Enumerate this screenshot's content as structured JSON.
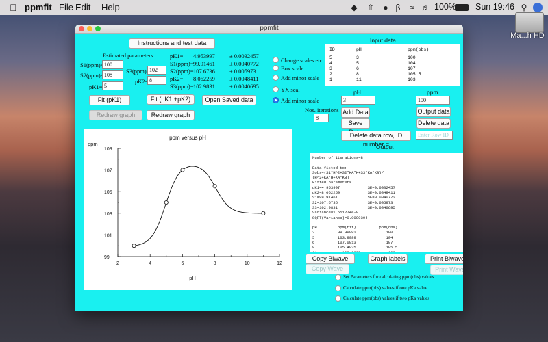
{
  "menubar": {
    "app_name": "ppmfit",
    "menus": [
      "File",
      "Edit",
      "Help"
    ],
    "battery": "100%",
    "clock": "Sun 19:46"
  },
  "desktop": {
    "hd_label": "Ma...h HD"
  },
  "window": {
    "title": "ppmfit"
  },
  "buttons": {
    "instructions": "Instructions and test data",
    "fit_pk1": "Fit (pK1)",
    "fit_pk1_pk2": "Fit (pK1 +pK2)",
    "open_saved": "Open Saved data",
    "redraw_disabled": "Redraw graph",
    "redraw": "Redraw graph",
    "add_data": "Add Data",
    "save_data": "Save Data",
    "delete_row": "Delete data row, ID number =",
    "output_data": "Output data",
    "delete_data": "Delete data",
    "copy_biwave": "Copy Biwave",
    "copy_wave": "Copy Wave",
    "graph_labels": "Graph labels",
    "print_biwave": "Print Biwave",
    "print_wave": "Print Wave"
  },
  "params": {
    "estimated_label": "Estimated parameters",
    "s1_label": "S1(ppm)=",
    "s1_value": "100",
    "s2_label": "S2(ppm)=",
    "s2_value": "108",
    "pk1_label": "pK1=",
    "pk1_value": "5",
    "s3_label": "S3(ppm)=",
    "s3_value": "102",
    "pk2_label": "pK2=",
    "pk2_value": "8",
    "nos_label": "Nos. iterations",
    "nos_value": "8"
  },
  "results": [
    {
      "label": "pK1=",
      "value": "4.953997",
      "err": "± 0.0032457"
    },
    {
      "label": "S1(ppm)=",
      "value": "99.91461",
      "err": "± 0.0040772"
    },
    {
      "label": "S2(ppm)=",
      "value": "107.6736",
      "err": "± 0.005973"
    },
    {
      "label": "pK2=",
      "value": "8.062259",
      "err": "± 0.0048411"
    },
    {
      "label": "S3(ppm)=",
      "value": "102.9831",
      "err": "± 0.0040695"
    }
  ],
  "radios": {
    "change_scales": "Change scales etc",
    "box_scale": "Box scale",
    "add_minor_1": "Add minor scale",
    "yx_scal": "YX scal",
    "add_minor_2": "Add minor scale"
  },
  "input_data": {
    "title": "Input data",
    "headers": [
      "ID",
      "pH",
      "ppm(obs)"
    ],
    "rows": [
      [
        "5",
        "3",
        "100"
      ],
      [
        "4",
        "5",
        "104"
      ],
      [
        "3",
        "6",
        "107"
      ],
      [
        "2",
        "8",
        "105.5"
      ],
      [
        "1",
        "11",
        "103"
      ]
    ],
    "ph_label": "pH",
    "ph_value": "3",
    "ppm_label": "ppm",
    "ppm_value": "100",
    "row_id_placeholder": "Enter Row ID"
  },
  "output": {
    "title": "Output",
    "text": "Number of iterations=8\n\nData fitted to:-\nSobs=(S1*H^2+S2*KA*H+S3*KA*KB)/\n(H^2+KA*H+KA*KB)\nFitted parameters\npK1=4.953997            SE=0.0032457\npK2=8.062259            SE=0.0048411\nS1=99.91461             SE=0.0040772\nS2=107.6736             SE=0.005973\nS3=102.9831             SE=0.0040695\nVariance=1.551274e-9\nSQRT(Variance)=0.0000394\n\npH         ppm(fit)          ppm(obs)\n3          99.99992             100\n5          103.9989             104\n6          107.0013             107\n8          105.4935             105.5\n11           102.9985            103"
  },
  "options": {
    "set_params": "Set Parameters for calculating ppm(obs) values",
    "one_pka": "Calculate ppm(obs) values if one pKa value",
    "two_pka": "Calculate ppm(obs) values if two pKa values"
  },
  "chart_data": {
    "type": "scatter",
    "title": "ppm versus pH",
    "xlabel": "pH",
    "ylabel": "ppm",
    "xlim": [
      2,
      12
    ],
    "ylim": [
      99,
      109
    ],
    "xticks": [
      "2",
      "4",
      "6",
      "8",
      "10",
      "12"
    ],
    "yticks": [
      "99",
      "101",
      "103",
      "105",
      "107",
      "109"
    ],
    "points": [
      {
        "x": 3,
        "y": 100
      },
      {
        "x": 5,
        "y": 104
      },
      {
        "x": 6,
        "y": 107
      },
      {
        "x": 8,
        "y": 105.5
      },
      {
        "x": 11,
        "y": 103
      }
    ],
    "fit_params": {
      "pK1": 4.953997,
      "pK2": 8.062259,
      "S1": 99.91461,
      "S2": 107.6736,
      "S3": 102.9831
    }
  }
}
